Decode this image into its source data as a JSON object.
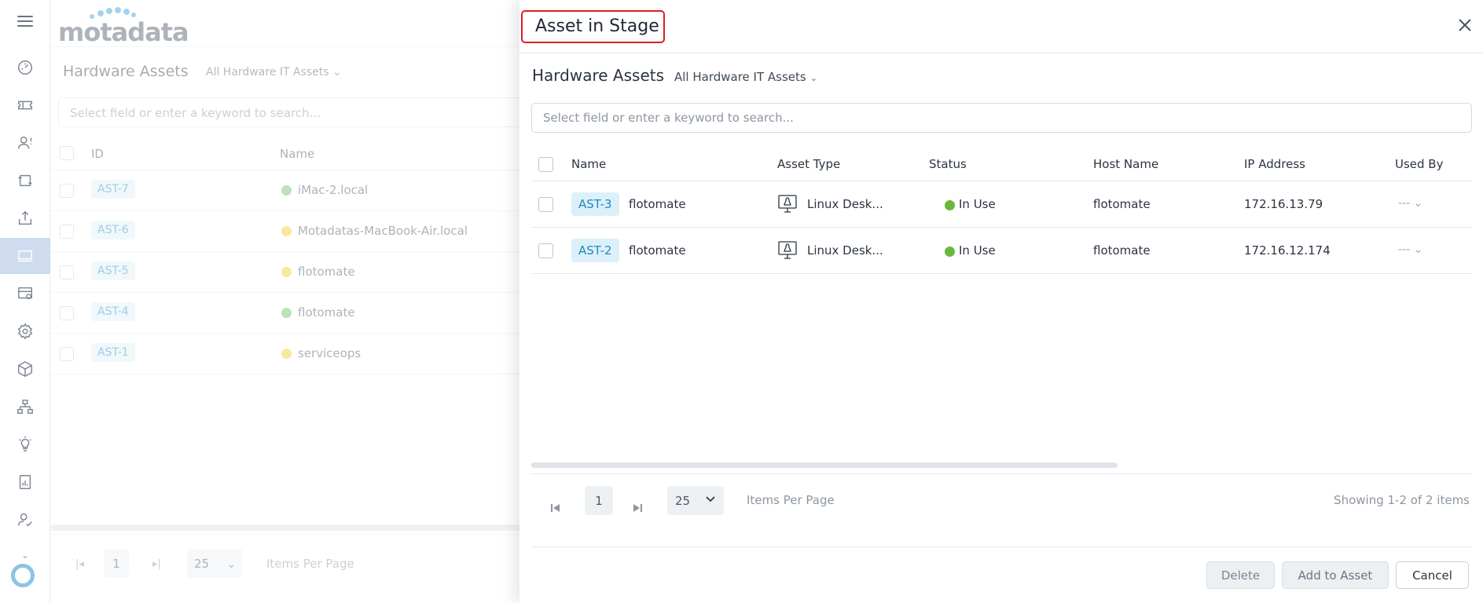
{
  "brand": {
    "logo_text": "motadata"
  },
  "background": {
    "title": "Hardware Assets",
    "filter": "All Hardware IT Assets",
    "search_placeholder": "Select field or enter a keyword to search...",
    "columns": [
      "ID",
      "Name"
    ],
    "rows": [
      {
        "id": "AST-7",
        "name": "iMac-2.local",
        "dot": "#6bc168"
      },
      {
        "id": "AST-6",
        "name": "Motadatas-MacBook-Air.local",
        "dot": "#f2cc2a"
      },
      {
        "id": "AST-5",
        "name": "flotomate",
        "dot": "#f2cc2a"
      },
      {
        "id": "AST-4",
        "name": "flotomate",
        "dot": "#6bc168"
      },
      {
        "id": "AST-1",
        "name": "serviceops",
        "dot": "#f2cc2a"
      }
    ],
    "pager": {
      "page": "1",
      "per_page": "25",
      "items_per_page": "Items Per Page"
    }
  },
  "drawer": {
    "title": "Asset in Stage",
    "section_title": "Hardware Assets",
    "filter": "All Hardware IT Assets",
    "search_placeholder": "Select field or enter a keyword to search...",
    "columns": {
      "name": "Name",
      "asset_type": "Asset Type",
      "status": "Status",
      "host_name": "Host Name",
      "ip_address": "IP Address",
      "used_by": "Used By"
    },
    "rows": [
      {
        "id": "AST-3",
        "name": "flotomate",
        "asset_type": "Linux Desk...",
        "status": "In Use",
        "host": "flotomate",
        "ip": "172.16.13.79",
        "used_by": "--- ⌄"
      },
      {
        "id": "AST-2",
        "name": "flotomate",
        "asset_type": "Linux Desk...",
        "status": "In Use",
        "host": "flotomate",
        "ip": "172.16.12.174",
        "used_by": "--- ⌄"
      }
    ],
    "pager": {
      "page": "1",
      "per_page": "25",
      "items_per_page": "Items Per Page",
      "showing": "Showing 1-2 of 2 items"
    },
    "buttons": {
      "delete": "Delete",
      "add_to_asset": "Add to Asset",
      "cancel": "Cancel"
    }
  },
  "colors": {
    "accent": "#1f88c2",
    "in_use": "#6bb73c",
    "highlight_border": "#d81f26"
  }
}
